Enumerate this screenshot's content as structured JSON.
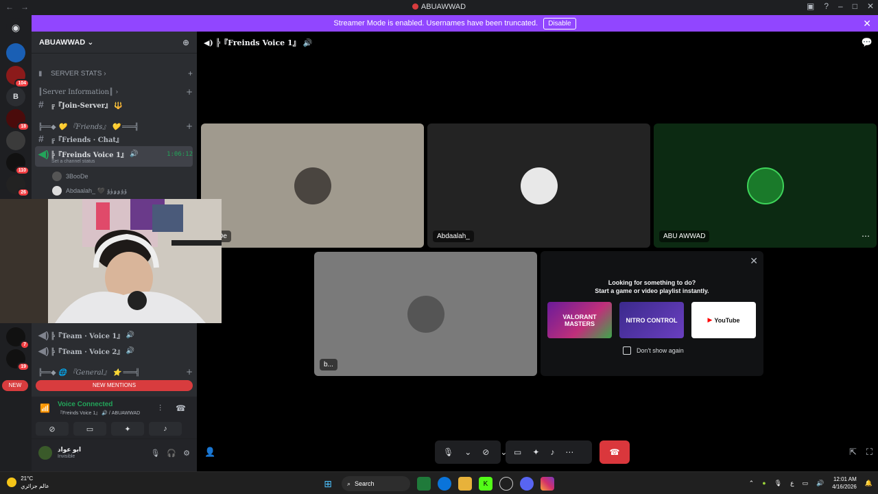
{
  "window": {
    "title": "ABUAWWAD"
  },
  "banner": {
    "message": "Streamer Mode is enabled. Usernames have been truncated.",
    "button": "Disable"
  },
  "servers": {
    "items": [
      {
        "label": "",
        "badge": ""
      },
      {
        "label": "",
        "badge": "104"
      },
      {
        "label": "B",
        "badge": ""
      },
      {
        "label": "",
        "badge": "18"
      },
      {
        "label": "",
        "badge": ""
      },
      {
        "label": "",
        "badge": "110"
      },
      {
        "label": "",
        "badge": "26"
      }
    ],
    "lower": [
      {
        "badge": "7"
      },
      {
        "badge": "19"
      }
    ],
    "new_label": "NEW"
  },
  "guild": {
    "name": "ABUAWWAD",
    "categories": {
      "server_stats": "SERVER STATS",
      "server_info": "║Server Information║",
      "friends": "╠══◆ 💛 『Friends』 💛 ═══╣",
      "general": "╠══◆ 🌐 『General』 ⭐ ═══╣"
    },
    "channels": {
      "join_server": "╔『Join-Server』 🔱",
      "friends_chat": "╔『Friends · Chat』",
      "friends_voice": "╠『Freinds Voice 1』",
      "team_voice_1": "╠『Team · Voice 1』",
      "team_voice_2": "╠『Team · Voice 2』"
    },
    "voice_timer": "1:06:12",
    "channel_status": "Set a channel status",
    "members": [
      "3BooDe",
      "Abdaalah_ 🖤 ۆۉۄۅۈۊ"
    ],
    "new_mentions": "NEW MENTIONS"
  },
  "voice": {
    "status": "Voice Connected",
    "location": "『Freinds Voice 1』 🔊 / ABUAWWAD"
  },
  "user": {
    "name": "ابو عواد",
    "status": "Invisible"
  },
  "stage": {
    "header": "╠『Freinds Voice 1』",
    "tiles": [
      {
        "name": "ooDe",
        "bg": "#a09a8e"
      },
      {
        "name": "Abdaalah_",
        "bg": "#232323"
      },
      {
        "name": "ABU AWWAD",
        "bg": "#0c2a12"
      },
      {
        "name": "b...",
        "bg": "#7a7a7a"
      }
    ],
    "activity": {
      "line1": "Looking for something to do?",
      "line2": "Start a game or video playlist instantly.",
      "cards": [
        {
          "label": "VALORANT MASTERS",
          "color": "#c0307a"
        },
        {
          "label": "NITRO CONTROL",
          "color": "#6a3fc0"
        },
        {
          "label": "YouTube",
          "color": "#ffffff"
        }
      ],
      "checkbox_label": "Don't show again"
    }
  },
  "taskbar": {
    "temp": "21°C",
    "weather_sub": "عالم جزائري",
    "search": "Search",
    "lang": "ع",
    "time": "12:01 AM",
    "date": "4/16/2026"
  },
  "colors": {
    "accent": "#9146ff",
    "danger": "#da373c",
    "green": "#23a55a"
  }
}
